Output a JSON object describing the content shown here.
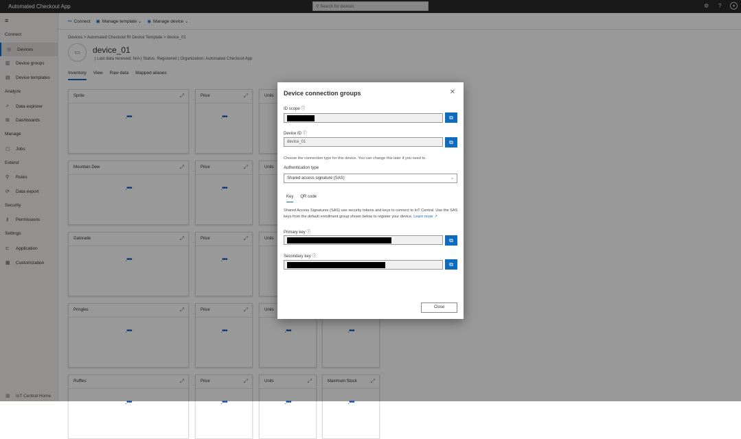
{
  "app": {
    "title": "Automated Checkout App",
    "search_placeholder": "Search for devices"
  },
  "sidebar": {
    "sections": [
      {
        "heading": "Connect",
        "items": [
          {
            "label": "Devices",
            "icon": "devices-icon"
          },
          {
            "label": "Device groups",
            "icon": "device-groups-icon"
          },
          {
            "label": "Device templates",
            "icon": "device-templates-icon"
          }
        ]
      },
      {
        "heading": "Analyze",
        "items": [
          {
            "label": "Data explorer",
            "icon": "chart-icon"
          },
          {
            "label": "Dashboards",
            "icon": "dashboard-icon"
          }
        ]
      },
      {
        "heading": "Manage",
        "items": [
          {
            "label": "Jobs",
            "icon": "jobs-icon"
          }
        ]
      },
      {
        "heading": "Extend",
        "items": [
          {
            "label": "Rules",
            "icon": "rules-icon"
          },
          {
            "label": "Data export",
            "icon": "export-icon"
          }
        ]
      },
      {
        "heading": "Security",
        "items": [
          {
            "label": "Permissions",
            "icon": "key-icon"
          }
        ]
      },
      {
        "heading": "Settings",
        "items": [
          {
            "label": "Application",
            "icon": "application-icon"
          },
          {
            "label": "Customization",
            "icon": "customization-icon"
          }
        ]
      }
    ],
    "footer": "IoT Central Home"
  },
  "commandbar": {
    "connect": "Connect",
    "manage_template": "Manage template",
    "manage_device": "Manage device"
  },
  "breadcrumb": "Devices > Automated Checkout RI Device Template > device_01",
  "device": {
    "name": "device_01",
    "meta": "| Last data received: N/A | Status: Registered | Organization: Automated Checkout App"
  },
  "tabs": [
    "Inventory",
    "View",
    "Raw data",
    "Mapped aliases"
  ],
  "cards": [
    [
      "Sprite",
      "Price",
      "Units",
      ""
    ],
    [
      "Mountain Dew",
      "Price",
      "Units",
      ""
    ],
    [
      "Gatorade",
      "Price",
      "Units",
      ""
    ],
    [
      "Pringles",
      "Price",
      "Units",
      ""
    ],
    [
      "Ruffles",
      "Price",
      "Units",
      "Maximum Stock"
    ]
  ],
  "modal": {
    "title": "Device connection groups",
    "id_scope_label": "ID scope",
    "device_id_label": "Device ID",
    "device_id_value": "device_01",
    "choose_text": "Choose the connection type for this device. You can change this later if you need to.",
    "auth_label": "Authentication type",
    "auth_value": "Shared access signature (SAS)",
    "tabs": [
      "Key",
      "QR code"
    ],
    "description": "Shared Access Signatures (SAS) use security tokens and keys to connect to IoT Central. Use the SAS keys from the default enrollment group shown below to register your device.",
    "learn_more": "Learn more",
    "primary_key_label": "Primary key",
    "secondary_key_label": "Secondary key",
    "close": "Close"
  }
}
